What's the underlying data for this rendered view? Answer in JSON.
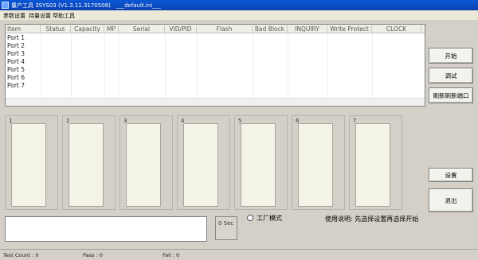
{
  "window": {
    "title": "量产工具 3SYS03 (V1.3.11.3170508)   ___default.ini___"
  },
  "menu": [
    "参数设置",
    "持量设置",
    "帮助工具"
  ],
  "table": {
    "columns": [
      "Item",
      "Status",
      "Capacity",
      "MP",
      "Serial",
      "VID/PID",
      "Flash",
      "Bad Block",
      "INQUIRY",
      "Write Protect",
      "CLOCK"
    ],
    "rows": [
      "Port 1",
      "Port 2",
      "Port 3",
      "Port 4",
      "Port 5",
      "Port 6",
      "Port 7"
    ]
  },
  "buttons": {
    "start": "开始",
    "debug": "调试",
    "refresh": "刷新刷新端口",
    "settings": "设置",
    "exit": "退出"
  },
  "panels": [
    "1",
    "2",
    "3",
    "4",
    "5",
    "6",
    "7"
  ],
  "bottom": {
    "small_button": "0 Sec",
    "factory_mode": "工厂模式",
    "hint": "使用说明: 先选择设置再选择开始"
  },
  "status": {
    "test_count": "Test Count : 0",
    "pass": "Pass : 0",
    "fail": "Fail : 0"
  }
}
